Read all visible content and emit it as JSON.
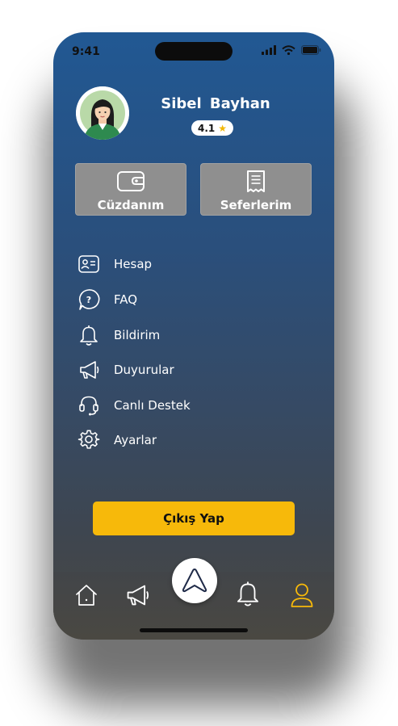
{
  "status_bar": {
    "time": "9:41"
  },
  "profile": {
    "name": "Sibel  Bayhan",
    "rating": "4.1",
    "rating_star": "★"
  },
  "cards": [
    {
      "label": "Cüzdanım",
      "icon": "wallet-icon"
    },
    {
      "label": "Seferlerim",
      "icon": "receipt-icon"
    }
  ],
  "menu": [
    {
      "label": "Hesap",
      "icon": "id-card-icon"
    },
    {
      "label": "FAQ",
      "icon": "question-bubble-icon"
    },
    {
      "label": "Bildirim",
      "icon": "bell-icon"
    },
    {
      "label": "Duyurular",
      "icon": "megaphone-icon"
    },
    {
      "label": "Canlı Destek",
      "icon": "headset-icon"
    },
    {
      "label": "Ayarlar",
      "icon": "gear-icon"
    }
  ],
  "logout_label": "Çıkış Yap",
  "tabbar": {
    "items": [
      "home-icon",
      "megaphone-icon",
      "navigation-arrow-icon",
      "bell-icon",
      "profile-icon"
    ],
    "active": "profile-icon",
    "active_color": "#f7b90a"
  },
  "colors": {
    "accent": "#f7b90a",
    "gradient_top": "#215893",
    "gradient_bottom": "#4a4842",
    "card_bg": "#8f8f8f"
  }
}
